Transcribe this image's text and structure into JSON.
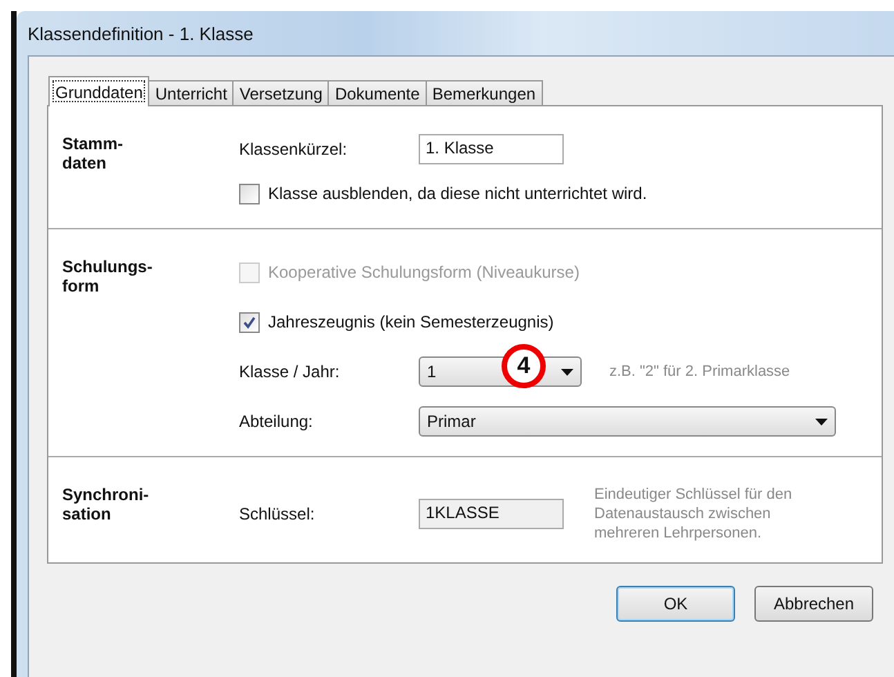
{
  "window": {
    "title": "Klassendefinition - 1. Klasse"
  },
  "tabs": [
    {
      "label": "Grunddaten",
      "selected": true
    },
    {
      "label": "Unterricht",
      "selected": false
    },
    {
      "label": "Versetzung",
      "selected": false
    },
    {
      "label": "Dokumente",
      "selected": false
    },
    {
      "label": "Bemerkungen",
      "selected": false
    }
  ],
  "sections": [
    {
      "heading": [
        "Stamm-",
        "daten"
      ],
      "rows": [
        {
          "kind": "text",
          "label": "Klassenkürzel:",
          "value": "1. Klasse",
          "disabled": false
        },
        {
          "kind": "checkbox",
          "label": "Klasse ausblenden, da diese nicht unterrichtet wird.",
          "checked": false,
          "disabled": false
        }
      ]
    },
    {
      "heading": [
        "Schulungs-",
        "form"
      ],
      "rows": [
        {
          "kind": "checkbox",
          "label": "Kooperative Schulungsform (Niveaukurse)",
          "checked": false,
          "disabled": true
        },
        {
          "kind": "checkbox",
          "label": "Jahreszeugnis (kein Semesterzeugnis)",
          "checked": true,
          "disabled": false
        },
        {
          "kind": "combo",
          "label": "Klasse / Jahr:",
          "value": "1",
          "hint": "z.B. \"2\" für 2. Primarklasse",
          "annotation": "4"
        },
        {
          "kind": "combo",
          "label": "Abteilung:",
          "value": "Primar"
        }
      ]
    },
    {
      "heading": [
        "Synchroni-",
        "sation"
      ],
      "rows": [
        {
          "kind": "text",
          "label": "Schlüssel:",
          "value": "1KLASSE",
          "disabled": true,
          "hint": "Eindeutiger Schlüssel für den Datenaustausch zwischen mehreren Lehrpersonen."
        }
      ]
    }
  ],
  "buttons": [
    {
      "label": "OK",
      "default": true
    },
    {
      "label": "Abbrechen",
      "default": false
    }
  ]
}
